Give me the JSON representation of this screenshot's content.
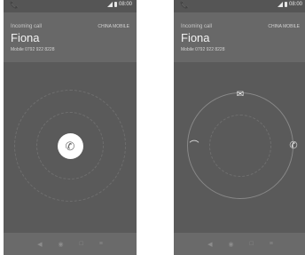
{
  "call": {
    "status": "Incoming call",
    "carrier": "CHINA MOBILE",
    "caller_name": "Fiona",
    "caller_number": "Mobile 0792 922 8228",
    "time": "08:00"
  },
  "icons": {
    "status_left": "phone-icon",
    "answer": "phone-icon",
    "message": "message-icon",
    "decline": "hang-up-icon",
    "accept": "phone-icon",
    "nav": [
      "volume-icon",
      "settings-icon",
      "square-icon",
      "menu-icon"
    ]
  },
  "colors": {
    "background": "#5a5a5a",
    "header": "#686868",
    "text": "#f2f2f2"
  }
}
